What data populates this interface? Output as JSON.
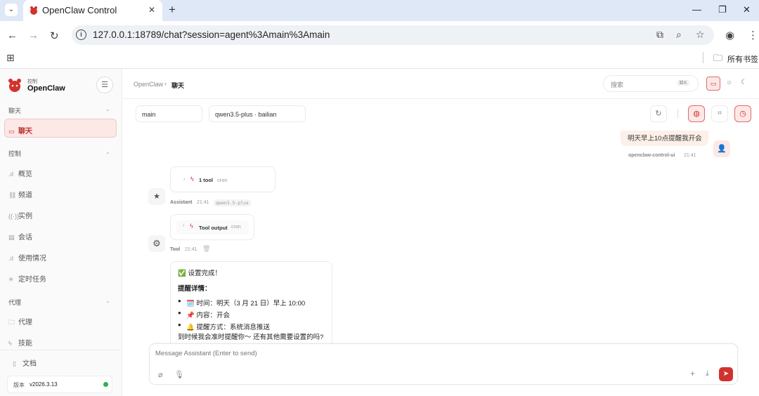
{
  "browser": {
    "tab_title": "OpenClaw Control",
    "url": "127.0.0.1:18789/chat?session=agent%3Amain%3Amain",
    "bookmarks_label": "所有书签"
  },
  "sidebar": {
    "brand_small": "控制",
    "brand_name": "OpenClaw",
    "sections": [
      {
        "title": "聊天",
        "items": [
          {
            "label": "聊天"
          }
        ]
      },
      {
        "title": "控制",
        "items": [
          {
            "label": "概览"
          },
          {
            "label": "频道"
          },
          {
            "label": "实例"
          },
          {
            "label": "会话"
          },
          {
            "label": "使用情况"
          },
          {
            "label": "定时任务"
          }
        ]
      },
      {
        "title": "代理",
        "items": [
          {
            "label": "代理"
          },
          {
            "label": "技能"
          }
        ]
      }
    ],
    "docs_label": "文档",
    "version_label": "版本",
    "version_value": "v2026.3.13"
  },
  "header": {
    "breadcrumb_root": "OpenClaw",
    "breadcrumb_sep": "›",
    "breadcrumb_current": "聊天",
    "search_placeholder": "搜索",
    "search_shortcut": "⌘K"
  },
  "toolbar": {
    "session_select": "main",
    "model_select": "qwen3.5-plus · bailian"
  },
  "chat": {
    "user_message": "明天早上10点提醒我开会",
    "user_sender": "openclaw-control-ui",
    "user_time": "21:41",
    "tool_call": {
      "count_label": "1 tool",
      "tool_name": "cron"
    },
    "assistant_sender": "Assistant",
    "assistant_time": "21:41",
    "assistant_model": "qwen3.5-plus",
    "tool_output": {
      "label": "Tool output",
      "tool_name": "cron"
    },
    "tool_sender": "Tool",
    "tool_time": "21:41",
    "reply": {
      "line1": "✅ 设置完成！",
      "heading": "提醒详情：",
      "bullets": [
        "🗓️ 时间：明天（3 月 21 日）早上 10:00",
        "📌 内容：开会",
        "🔔 提醒方式：系统消息推送"
      ],
      "closing": "到时候我会准时提醒你〜 还有其他需要设置的吗?"
    }
  },
  "composer": {
    "placeholder": "Message Assistant (Enter to send)"
  },
  "colors": {
    "accent": "#d2322e",
    "accent_bg": "#fde8e7",
    "online": "#2db34a"
  }
}
